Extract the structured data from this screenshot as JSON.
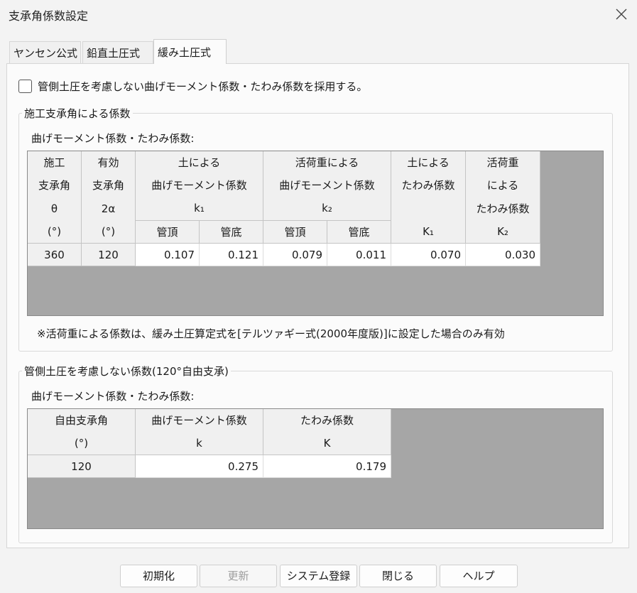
{
  "window": {
    "title": "支承角係数設定"
  },
  "tabs": [
    "ヤンセン公式",
    "鉛直土圧式",
    "緩み土圧式"
  ],
  "active_tab": 2,
  "checkbox": {
    "label": "管側土圧を考慮しない曲げモーメント係数・たわみ係数を採用する。",
    "checked": false
  },
  "group1": {
    "title": "施工支承角による係数",
    "subtitle": "曲げモーメント係数・たわみ係数:",
    "headers": {
      "col1": [
        "施工",
        "支承角",
        "θ",
        "(°)"
      ],
      "col2": [
        "有効",
        "支承角",
        "2α",
        "(°)"
      ],
      "moment_soil": [
        "土による",
        "曲げモーメント係数",
        "k₁"
      ],
      "moment_live": [
        "活荷重による",
        "曲げモーメント係数",
        "k₂"
      ],
      "defl_soil": [
        "土による",
        "たわみ係数",
        "K₁"
      ],
      "defl_live": [
        "活荷重",
        "による",
        "たわみ係数",
        "K₂"
      ],
      "sub_top": "管頂",
      "sub_bottom": "管底"
    },
    "row": {
      "theta": "360",
      "alpha": "120",
      "k1_top": "0.107",
      "k1_bottom": "0.121",
      "k2_top": "0.079",
      "k2_bottom": "0.011",
      "K1": "0.070",
      "K2": "0.030"
    },
    "note": "※活荷重による係数は、緩み土圧算定式を[テルツァギー式(2000年度版)]に設定した場合のみ有効"
  },
  "group2": {
    "title": "管側土圧を考慮しない係数(120°自由支承)",
    "subtitle": "曲げモーメント係数・たわみ係数:",
    "headers": {
      "col1": [
        "自由支承角",
        "(°)"
      ],
      "col2": [
        "曲げモーメント係数",
        "k"
      ],
      "col3": [
        "たわみ係数",
        "K"
      ]
    },
    "row": {
      "angle": "120",
      "k": "0.275",
      "K": "0.179"
    }
  },
  "buttons": {
    "init": "初期化",
    "update": "更新",
    "register": "システム登録",
    "close": "閉じる",
    "help": "ヘルプ"
  },
  "colors": {
    "grid_background": "#a6a6a6",
    "header_cell": "#f0f0f0",
    "value_cell": "#ffffff"
  },
  "icons": {
    "close": "close-icon"
  }
}
